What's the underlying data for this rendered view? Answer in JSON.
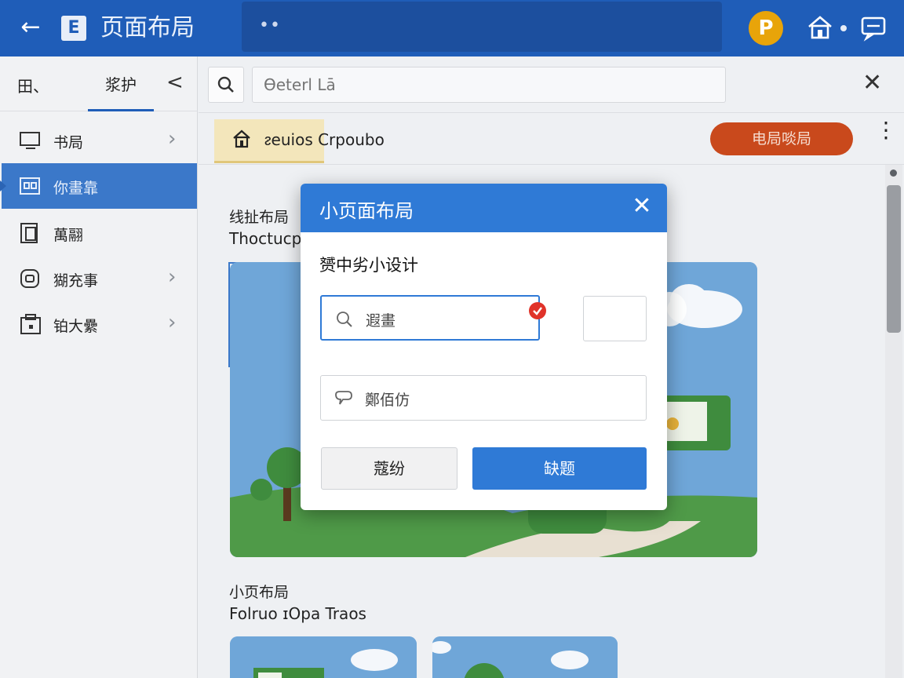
{
  "app": {
    "title": "页面布局",
    "avatar_letter": "P",
    "colors": {
      "accent": "#1f5db8",
      "primary_button": "#2f7ad6",
      "action_pill": "#c9491c",
      "avatar": "#e8a40a"
    }
  },
  "sidebar": {
    "tabs": [
      {
        "label": "田、"
      },
      {
        "label": "浆护"
      }
    ],
    "items": [
      {
        "label": "书局",
        "icon": "monitor-icon"
      },
      {
        "label": "你畫靠",
        "icon": "grid-icon"
      },
      {
        "label": "萬翮",
        "icon": "document-icon"
      },
      {
        "label": "猢充事",
        "icon": "badge-icon"
      },
      {
        "label": "铂大纍",
        "icon": "building-icon"
      }
    ]
  },
  "search": {
    "placeholder": "Ɵeterl Lā"
  },
  "breadcrumb": {
    "label": "ᴤeuios Crpoubo",
    "action_label": "电局啖局"
  },
  "content": {
    "section1": {
      "title": "线扯布局",
      "subtitle": "Thoctucp"
    },
    "section2": {
      "title": "小页布局",
      "subtitle": "Folruo ɪOpa Traos"
    }
  },
  "modal": {
    "title": "小页面布局",
    "label": "赟中劣小设计",
    "field1_text": "遐畫",
    "field3_text": "鄭佰仿",
    "cancel_label": "蔻纷",
    "ok_label": "缺题"
  }
}
